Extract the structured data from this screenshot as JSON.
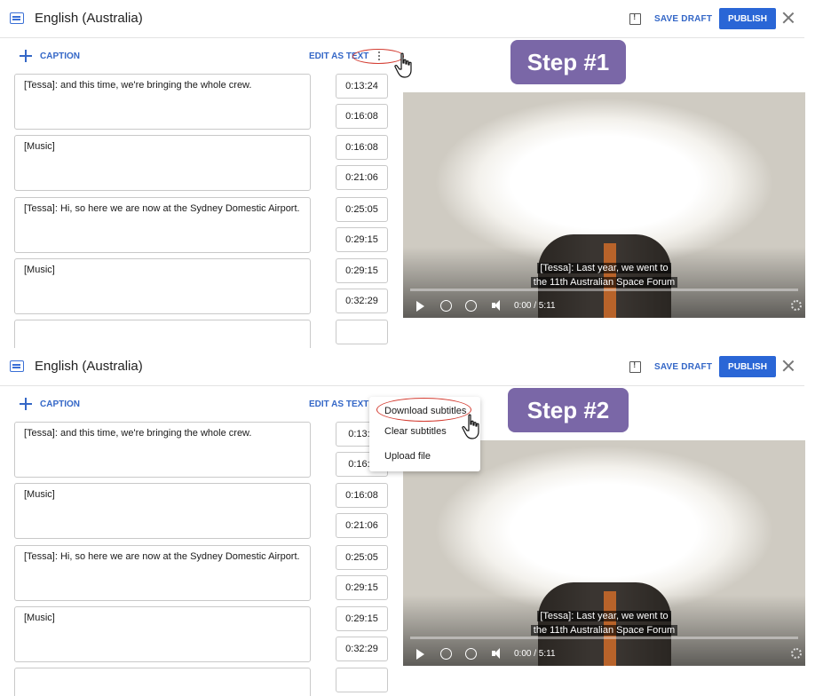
{
  "header": {
    "language_title": "English (Australia)",
    "save_draft_label": "SAVE DRAFT",
    "publish_label": "PUBLISH"
  },
  "toolbar": {
    "add_caption_label": "CAPTION",
    "edit_as_text_label": "EDIT AS TEXT"
  },
  "captions": [
    {
      "text": "[Tessa]: and this time, we're bringing the whole crew.",
      "start": "0:13:24",
      "end": "0:16:08"
    },
    {
      "text": "[Music]",
      "start": "0:16:08",
      "end": "0:21:06"
    },
    {
      "text": "[Tessa]: Hi, so here we are now at the Sydney Domestic Airport.",
      "start": "0:25:05",
      "end": "0:29:15"
    },
    {
      "text": "[Music]",
      "start": "0:29:15",
      "end": "0:32:29"
    }
  ],
  "captions_panel2_start_times": [
    "0:13:2",
    "0:16:0"
  ],
  "video": {
    "subtitle_line1": "[Tessa]: Last year, we went to",
    "subtitle_line2": "the 11th Australian Space Forum",
    "timecode": "0:00 / 5:11"
  },
  "step_labels": {
    "step1": "Step #1",
    "step2": "Step #2"
  },
  "options_menu": {
    "items": [
      "Download subtitles",
      "Clear subtitles",
      "Upload file"
    ]
  },
  "colors": {
    "accent": "#2a66d6",
    "step_badge": "#7a67a7",
    "highlight_ring": "#d33a2f"
  },
  "icons": [
    "language-icon",
    "feedback-icon",
    "close-icon",
    "plus-icon",
    "more-vert-icon",
    "play-icon",
    "rewind-icon",
    "forward-icon",
    "volume-icon",
    "settings-icon",
    "pointer-hand-icon"
  ]
}
